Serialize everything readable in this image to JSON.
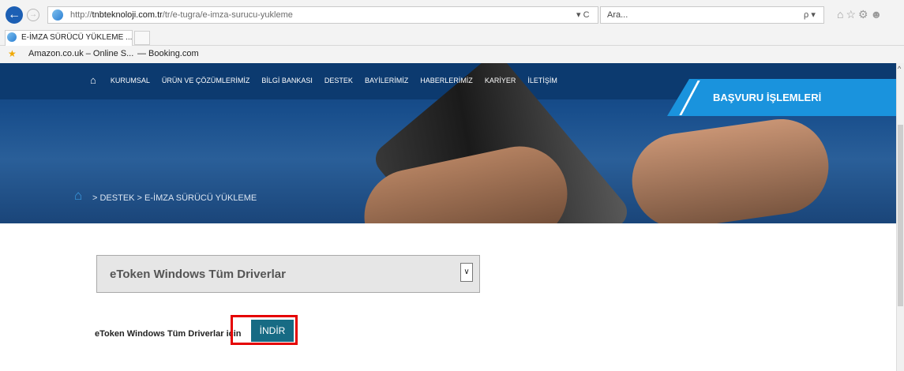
{
  "browser": {
    "url_prefix": "http://",
    "url_host": "tnbteknoloji.com.tr",
    "url_path": "/tr/e-tugra/e-imza-surucu-yukleme",
    "addr_tools": "▾ C",
    "search_placeholder": "Ara...",
    "search_tools": "ρ ▾",
    "right_icons": "⌂☆⚙☻",
    "back_icon": "←",
    "fwd_icon": "→",
    "tab_title": "E-İMZA SÜRÜCÜ YÜKLEME ... ×",
    "favorites": [
      "Amazon.co.uk – Online S...",
      "— Booking.com"
    ],
    "fav_star": "★"
  },
  "site": {
    "home_icon": "home-icon",
    "home_glyph": "⌂",
    "menu": [
      "KURUMSAL",
      "ÜRÜN VE ÇÖZÜMLERİMİZ",
      "BİLGİ BANKASI",
      "DESTEK",
      "BAYİLERİMİZ",
      "HABERLERİMİZ",
      "KARİYER",
      "İLETİŞİM"
    ],
    "apply_button": "BAŞVURU İŞLEMLERİ",
    "breadcrumb": "> DESTEK > E-İMZA SÜRÜCÜ YÜKLEME"
  },
  "main": {
    "select_value": "eToken Windows Tüm Driverlar",
    "select_arrow": "∨",
    "download_text": "eToken Windows Tüm Driverlar için",
    "download_button": "İNDİR"
  },
  "scroll_icon": "^",
  "colors": {
    "brand_blue": "#1a93dd",
    "button_teal": "#176b84",
    "highlight_red": "#e50000"
  }
}
